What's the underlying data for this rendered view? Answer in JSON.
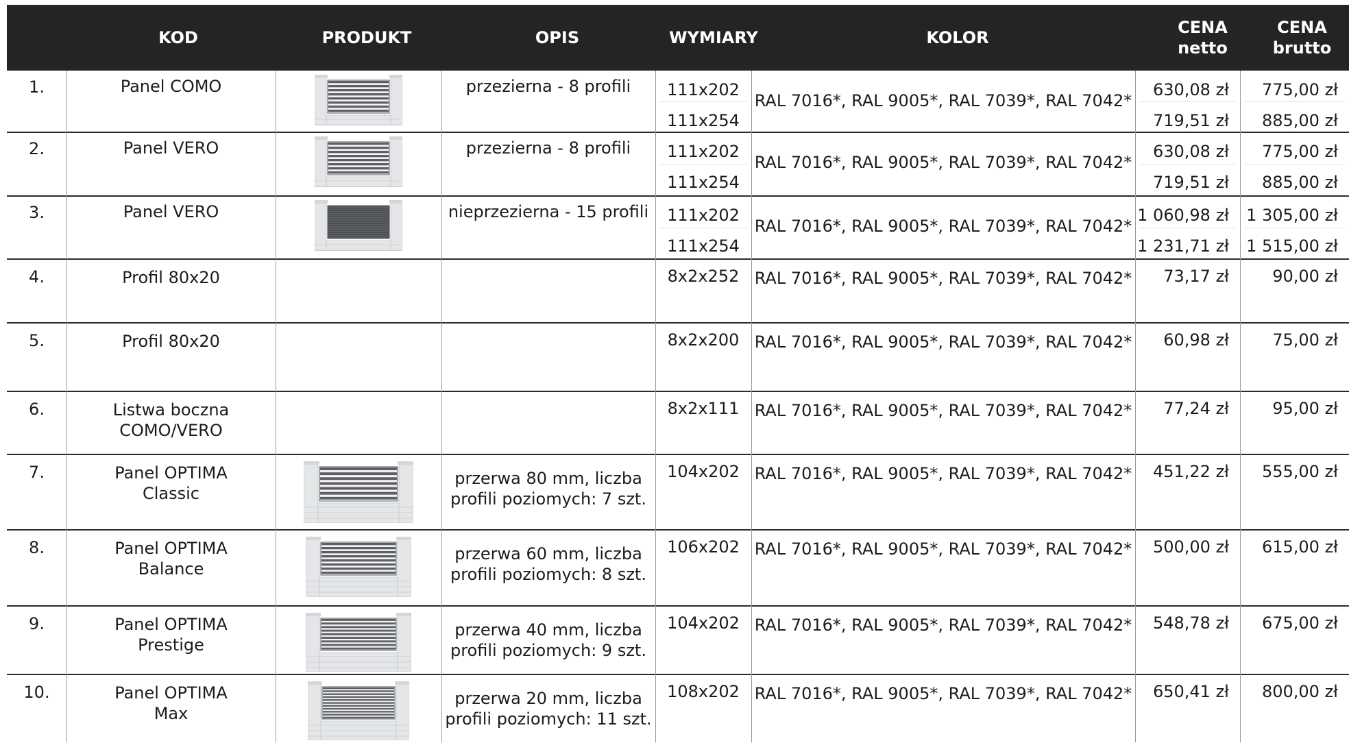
{
  "headers": {
    "kod": "KOD",
    "produkt": "PRODUKT",
    "opis": "OPIS",
    "wymiary": "WYMIARY",
    "kolor": "KOLOR",
    "cena_netto_1": "CENA",
    "cena_netto_2": "netto",
    "cena_brutto_1": "CENA",
    "cena_brutto_2": "brutto"
  },
  "rows": [
    {
      "num": "1.",
      "kod": "Panel COMO",
      "kod2": "",
      "opis": "przezierna - 8 profili",
      "opis2": "",
      "wym": [
        "111x202",
        "111x254"
      ],
      "kolor": "RAL 7016*, RAL 9005*, RAL 7039*, RAL 7042*",
      "netto": [
        "630,08 zł",
        "719,51 zł"
      ],
      "brutto": [
        "775,00 zł",
        "885,00 zł"
      ]
    },
    {
      "num": "2.",
      "kod": "Panel VERO",
      "kod2": "",
      "opis": "przezierna - 8 profili",
      "opis2": "",
      "wym": [
        "111x202",
        "111x254"
      ],
      "kolor": "RAL 7016*, RAL 9005*, RAL 7039*, RAL 7042*",
      "netto": [
        "630,08 zł",
        "719,51 zł"
      ],
      "brutto": [
        "775,00 zł",
        "885,00 zł"
      ]
    },
    {
      "num": "3.",
      "kod": "Panel VERO",
      "kod2": "",
      "opis": "nieprzezierna - 15 profili",
      "opis2": "",
      "wym": [
        "111x202",
        "111x254"
      ],
      "kolor": "RAL 7016*, RAL 9005*, RAL 7039*, RAL 7042*",
      "netto": [
        "1 060,98 zł",
        "1 231,71 zł"
      ],
      "brutto": [
        "1 305,00 zł",
        "1 515,00 zł"
      ]
    },
    {
      "num": "4.",
      "kod": "Profil 80x20",
      "kod2": "",
      "opis": "",
      "opis2": "",
      "wym": [
        "8x2x252"
      ],
      "kolor": "RAL 7016*, RAL 9005*, RAL 7039*, RAL 7042*",
      "netto": [
        "73,17 zł"
      ],
      "brutto": [
        "90,00 zł"
      ]
    },
    {
      "num": "5.",
      "kod": "Profil 80x20",
      "kod2": "",
      "opis": "",
      "opis2": "",
      "wym": [
        "8x2x200"
      ],
      "kolor": "RAL 7016*, RAL 9005*, RAL 7039*, RAL 7042*",
      "netto": [
        "60,98 zł"
      ],
      "brutto": [
        "75,00 zł"
      ]
    },
    {
      "num": "6.",
      "kod": "Listwa boczna",
      "kod2": "COMO/VERO",
      "opis": "",
      "opis2": "",
      "wym": [
        "8x2x111"
      ],
      "kolor": "RAL 7016*, RAL 9005*, RAL 7039*, RAL 7042*",
      "netto": [
        "77,24 zł"
      ],
      "brutto": [
        "95,00 zł"
      ]
    },
    {
      "num": "7.",
      "kod": "Panel OPTIMA",
      "kod2": "Classic",
      "opis": "przerwa 80 mm, liczba",
      "opis2": "profili poziomych: 7 szt.",
      "wym": [
        "104x202"
      ],
      "kolor": "RAL 7016*, RAL 9005*, RAL 7039*, RAL 7042*",
      "netto": [
        "451,22 zł"
      ],
      "brutto": [
        "555,00 zł"
      ]
    },
    {
      "num": "8.",
      "kod": "Panel OPTIMA",
      "kod2": "Balance",
      "opis": "przerwa 60 mm, liczba",
      "opis2": "profili poziomych: 8 szt.",
      "wym": [
        "106x202"
      ],
      "kolor": "RAL 7016*, RAL 9005*, RAL 7039*, RAL 7042*",
      "netto": [
        "500,00 zł"
      ],
      "brutto": [
        "615,00 zł"
      ]
    },
    {
      "num": "9.",
      "kod": "Panel OPTIMA",
      "kod2": "Prestige",
      "opis": "przerwa 40 mm, liczba",
      "opis2": "profili poziomych: 9 szt.",
      "wym": [
        "104x202"
      ],
      "kolor": "RAL 7016*, RAL 9005*, RAL 7039*, RAL 7042*",
      "netto": [
        "548,78 zł"
      ],
      "brutto": [
        "675,00 zł"
      ]
    },
    {
      "num": "10.",
      "kod": "Panel OPTIMA",
      "kod2": "Max",
      "opis": "przerwa 20 mm, liczba",
      "opis2": "profili poziomych: 11 szt.",
      "wym": [
        "108x202"
      ],
      "kolor": "RAL 7016*, RAL 9005*, RAL 7039*, RAL 7042*",
      "netto": [
        "650,41 zł"
      ],
      "brutto": [
        "800,00 zł"
      ]
    }
  ],
  "colors": {
    "header_bg": "#242424",
    "panel": "#5d5f62",
    "wall": "#e4e6e8"
  }
}
